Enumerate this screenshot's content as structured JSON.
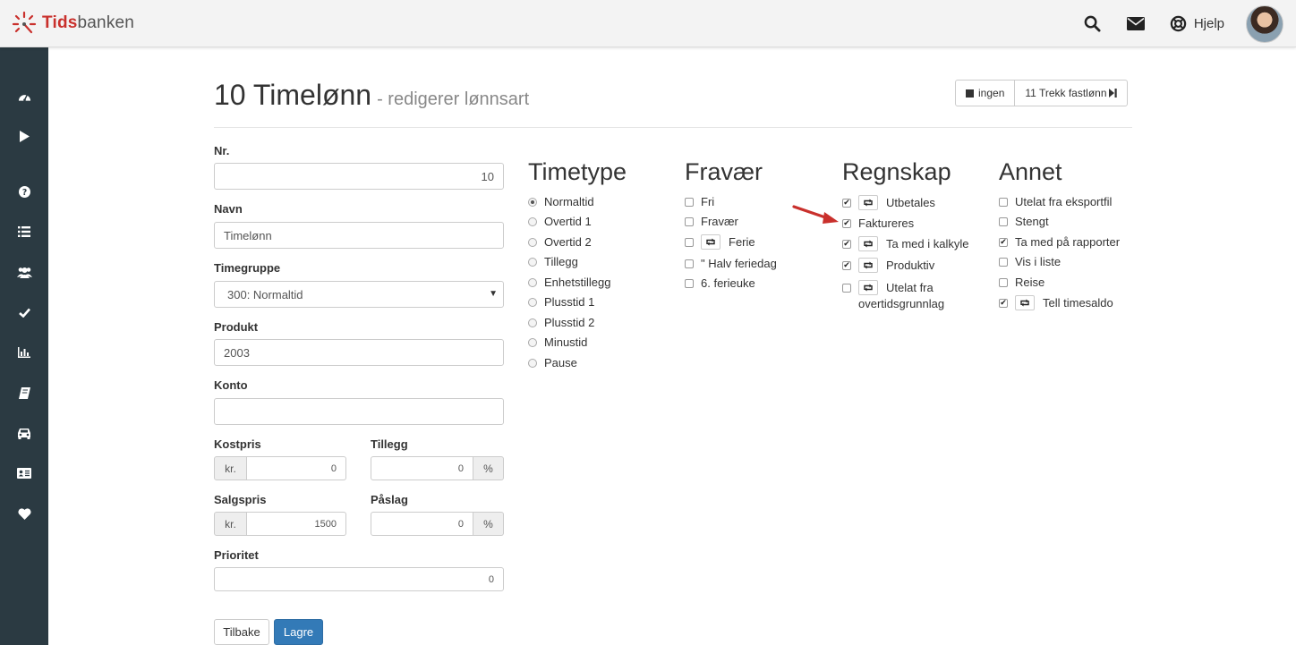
{
  "app": {
    "logo_part1": "Tids",
    "logo_part2": "banken",
    "help_label": "Hjelp",
    "accent_color": "#c9302c",
    "sidebar_color": "#2b3a42"
  },
  "header_icons": [
    "search-icon",
    "mail-icon",
    "lifebuoy-icon"
  ],
  "sidebar": {
    "items": [
      {
        "icon": "dashboard-icon"
      },
      {
        "icon": "play-icon"
      },
      {
        "icon": "question-icon"
      },
      {
        "icon": "list-icon"
      },
      {
        "icon": "users-icon"
      },
      {
        "icon": "check-icon"
      },
      {
        "icon": "bar-chart-icon"
      },
      {
        "icon": "book-icon"
      },
      {
        "icon": "car-icon"
      },
      {
        "icon": "id-card-icon"
      },
      {
        "icon": "heart-icon"
      }
    ]
  },
  "page": {
    "title": "10 Timelønn",
    "subtitle": "- redigerer lønnsart",
    "nav_prev_label": "ingen",
    "nav_next_label": "11 Trekk fastlønn"
  },
  "form": {
    "nr_label": "Nr.",
    "nr_value": "10",
    "navn_label": "Navn",
    "navn_value": "Timelønn",
    "timegruppe_label": "Timegruppe",
    "timegruppe_value": "300: Normaltid",
    "produkt_label": "Produkt",
    "produkt_value": "2003",
    "konto_label": "Konto",
    "konto_value": "",
    "kostpris_label": "Kostpris",
    "kostpris_prefix": "kr.",
    "kostpris_value": "0",
    "tillegg_label": "Tillegg",
    "tillegg_value": "0",
    "tillegg_suffix": "%",
    "salgspris_label": "Salgspris",
    "salgspris_prefix": "kr.",
    "salgspris_value": "1500",
    "paslag_label": "Påslag",
    "paslag_value": "0",
    "paslag_suffix": "%",
    "prioritet_label": "Prioritet",
    "prioritet_value": "0",
    "back_label": "Tilbake",
    "save_label": "Lagre"
  },
  "timetype": {
    "heading": "Timetype",
    "options": [
      {
        "label": "Normaltid",
        "selected": true
      },
      {
        "label": "Overtid 1",
        "selected": false
      },
      {
        "label": "Overtid 2",
        "selected": false
      },
      {
        "label": "Tillegg",
        "selected": false
      },
      {
        "label": "Enhetstillegg",
        "selected": false
      },
      {
        "label": "Plusstid 1",
        "selected": false
      },
      {
        "label": "Plusstid 2",
        "selected": false
      },
      {
        "label": "Minustid",
        "selected": false
      },
      {
        "label": "Pause",
        "selected": false
      }
    ]
  },
  "fravaer": {
    "heading": "Fravær",
    "options": [
      {
        "label": "Fri",
        "checked": false,
        "sync": false
      },
      {
        "label": "Fravær",
        "checked": false,
        "sync": false
      },
      {
        "label": "Ferie",
        "checked": false,
        "sync": true
      },
      {
        "label": "\" Halv feriedag",
        "checked": false,
        "sync": false
      },
      {
        "label": "6. ferieuke",
        "checked": false,
        "sync": false
      }
    ]
  },
  "regnskap": {
    "heading": "Regnskap",
    "options": [
      {
        "label": "Utbetales",
        "checked": true,
        "sync": true
      },
      {
        "label": "Faktureres",
        "checked": true,
        "sync": false
      },
      {
        "label": "Ta med i kalkyle",
        "checked": true,
        "sync": true
      },
      {
        "label": "Produktiv",
        "checked": true,
        "sync": true
      },
      {
        "label": "Utelat fra",
        "label_line2": "overtidsgrunnlag",
        "checked": false,
        "sync": true
      }
    ]
  },
  "annet": {
    "heading": "Annet",
    "options": [
      {
        "label": "Utelat fra eksportfil",
        "checked": false,
        "sync": false
      },
      {
        "label": "Stengt",
        "checked": false,
        "sync": false
      },
      {
        "label": "Ta med på rapporter",
        "checked": true,
        "sync": false
      },
      {
        "label": "Vis i liste",
        "checked": false,
        "sync": false
      },
      {
        "label": "Reise",
        "checked": false,
        "sync": false
      },
      {
        "label": "Tell timesaldo",
        "checked": true,
        "sync": true
      }
    ]
  }
}
